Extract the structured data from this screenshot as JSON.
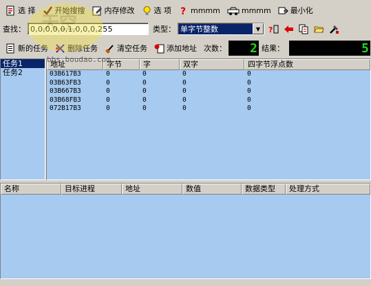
{
  "toolbar": {
    "select_label": "选 择",
    "start_search_label": "开始搜搜",
    "mem_edit_label": "内存修改",
    "options_label": "选 项",
    "help_label": "mmmm",
    "car_label": "mmmm",
    "minimize_label": "最小化"
  },
  "search": {
    "label": "查找：",
    "value": "0,0,0,0,0,1,0,0,0,255",
    "type_label": "类型：",
    "type_value": "单字节整数"
  },
  "tasks_bar": {
    "new_task": "新的任务",
    "delete_task": "删除任务",
    "clear_task": "清空任务",
    "add_address": "添加地址",
    "count_label": "次数：",
    "count_value": "2",
    "result_label": "结果：",
    "result_value": "5"
  },
  "task_list": [
    "任务1",
    "任务2"
  ],
  "address_table": {
    "columns": [
      "地址",
      "字节",
      "字",
      "双字",
      "四字节浮点数"
    ],
    "rows": [
      [
        "03B617B3",
        "0",
        "0",
        "0",
        "0"
      ],
      [
        "03B63FB3",
        "0",
        "0",
        "0",
        "0"
      ],
      [
        "03B667B3",
        "0",
        "0",
        "0",
        "0"
      ],
      [
        "03B68FB3",
        "0",
        "0",
        "0",
        "0"
      ],
      [
        "072B17B3",
        "0",
        "0",
        "0",
        "0"
      ]
    ]
  },
  "bottom_table": {
    "columns": [
      "名称",
      "目标进程",
      "地址",
      "数值",
      "数据类型",
      "处理方式"
    ]
  },
  "watermark": {
    "url": "bbs.boudao.com"
  },
  "colors": {
    "pane_bg": "#a6caf0",
    "face": "#d4d0c8",
    "lcd_text": "#22d422",
    "selection": "#0a246a"
  }
}
